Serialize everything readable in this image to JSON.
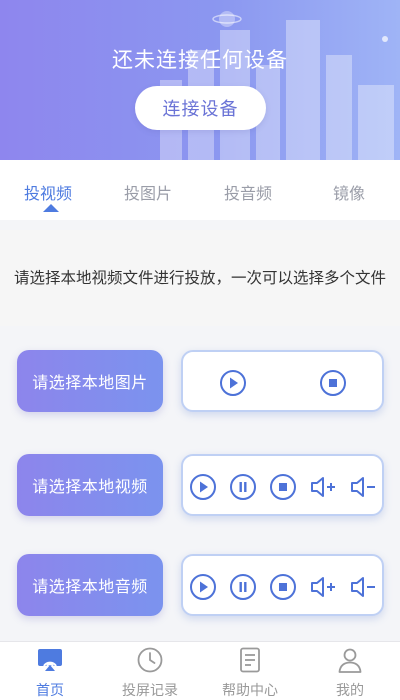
{
  "header": {
    "status_text": "还未连接任何设备",
    "connect_button": "连接设备"
  },
  "tabs": [
    {
      "label": "投视频",
      "active": true
    },
    {
      "label": "投图片",
      "active": false
    },
    {
      "label": "投音频",
      "active": false
    },
    {
      "label": "镜像",
      "active": false
    }
  ],
  "hint_text": "请选择本地视频文件进行投放，一次可以选择多个文件",
  "sections": [
    {
      "button": "请选择本地图片",
      "controls": [
        "play-icon",
        "stop-icon"
      ]
    },
    {
      "button": "请选择本地视频",
      "controls": [
        "play-icon",
        "pause-icon",
        "stop-icon",
        "volume-up-icon",
        "volume-down-icon"
      ]
    },
    {
      "button": "请选择本地音频",
      "controls": [
        "play-icon",
        "pause-icon",
        "stop-icon",
        "volume-up-icon",
        "volume-down-icon"
      ]
    }
  ],
  "bottom_nav": [
    {
      "label": "首页",
      "icon": "cast-icon",
      "active": true
    },
    {
      "label": "投屏记录",
      "icon": "clock-icon",
      "active": false
    },
    {
      "label": "帮助中心",
      "icon": "document-icon",
      "active": false
    },
    {
      "label": "我的",
      "icon": "user-icon",
      "active": false
    }
  ],
  "colors": {
    "accent": "#4e7be0",
    "header_gradient_start": "#8e86ee",
    "header_gradient_end": "#9fb4f6",
    "control_icon": "#4d72d8"
  }
}
